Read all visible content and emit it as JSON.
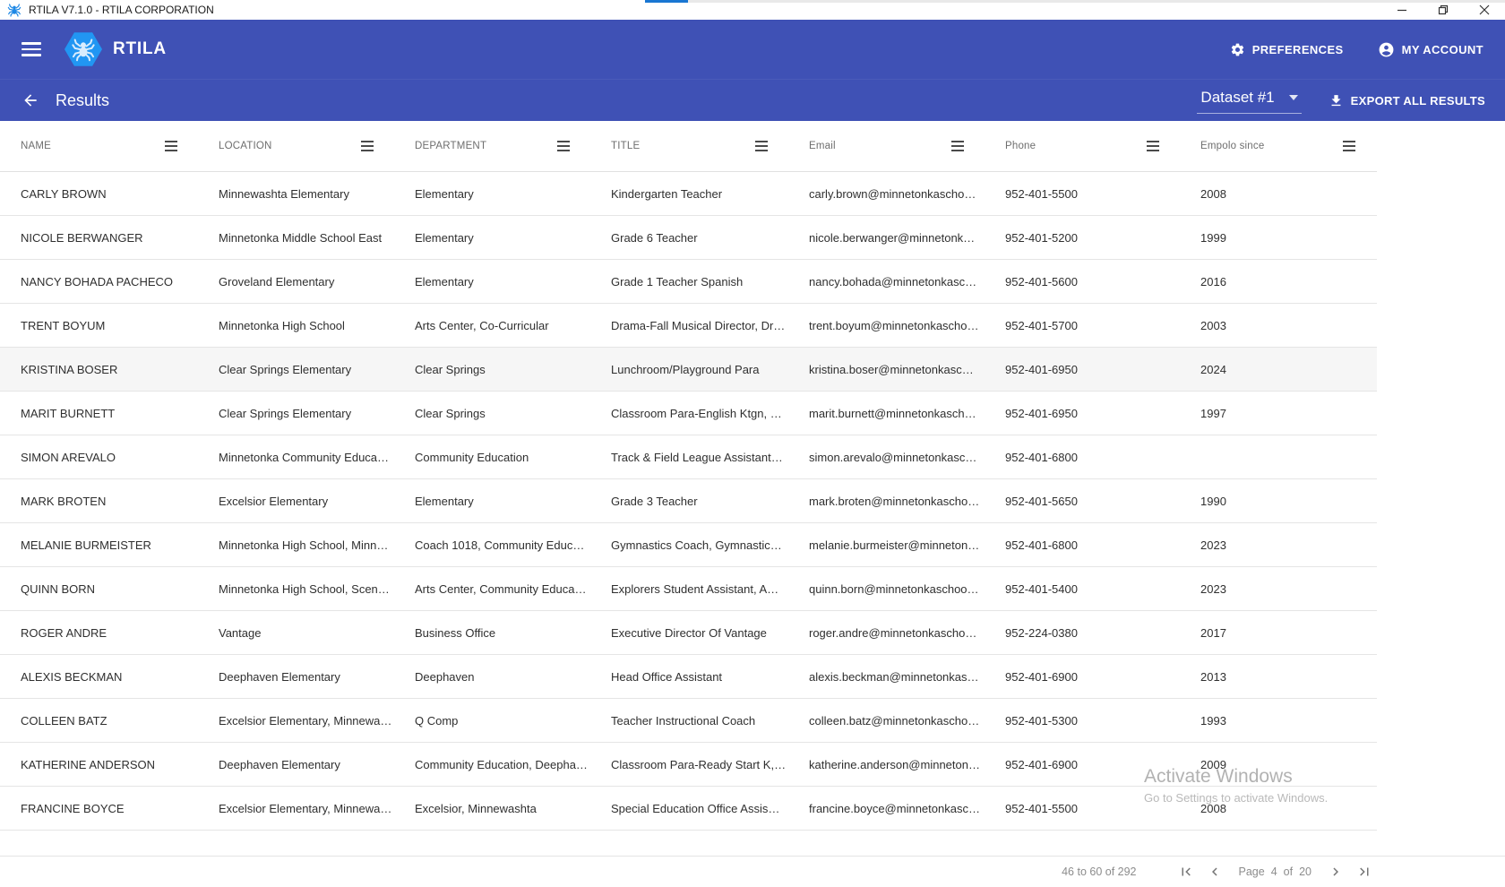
{
  "window": {
    "title": "RTILA V7.1.0 - RTILA CORPORATION"
  },
  "app_header": {
    "brand": "RTILA",
    "preferences_label": "PREFERENCES",
    "my_account_label": "MY ACCOUNT"
  },
  "results_bar": {
    "title": "Results",
    "dataset_label": "Dataset #1",
    "export_label": "EXPORT ALL RESULTS"
  },
  "table": {
    "fields": [
      "name",
      "location",
      "department",
      "title",
      "email",
      "phone",
      "employed_since"
    ],
    "columns": [
      {
        "label": "NAME"
      },
      {
        "label": "LOCATION"
      },
      {
        "label": "DEPARTMENT"
      },
      {
        "label": "TITLE"
      },
      {
        "label": "Email"
      },
      {
        "label": "Phone"
      },
      {
        "label": "Empolo since"
      }
    ],
    "rows": [
      {
        "highlighted": false,
        "cells": [
          "CARLY BROWN",
          "Minnewashta Elementary",
          "Elementary",
          "Kindergarten Teacher",
          "carly.brown@minnetonkascho…",
          "952-401-5500",
          "2008"
        ]
      },
      {
        "highlighted": false,
        "cells": [
          "NICOLE BERWANGER",
          "Minnetonka Middle School East",
          "Elementary",
          "Grade 6 Teacher",
          "nicole.berwanger@minnetonk…",
          "952-401-5200",
          "1999"
        ]
      },
      {
        "highlighted": false,
        "cells": [
          "NANCY BOHADA PACHECO",
          "Groveland Elementary",
          "Elementary",
          "Grade 1 Teacher Spanish",
          "nancy.bohada@minnetonkasc…",
          "952-401-5600",
          "2016"
        ]
      },
      {
        "highlighted": false,
        "cells": [
          "TRENT BOYUM",
          "Minnetonka High School",
          "Arts Center, Co-Curricular",
          "Drama-Fall Musical Director, Dr…",
          "trent.boyum@minnetonkascho…",
          "952-401-5700",
          "2003"
        ]
      },
      {
        "highlighted": true,
        "cells": [
          "KRISTINA BOSER",
          "Clear Springs Elementary",
          "Clear Springs",
          "Lunchroom/Playground Para",
          "kristina.boser@minnetonkasc…",
          "952-401-6950",
          "2024"
        ]
      },
      {
        "highlighted": false,
        "cells": [
          "MARIT BURNETT",
          "Clear Springs Elementary",
          "Clear Springs",
          "Classroom Para-English Ktgn, …",
          "marit.burnett@minnetonkasch…",
          "952-401-6950",
          "1997"
        ]
      },
      {
        "highlighted": false,
        "cells": [
          "SIMON AREVALO",
          "Minnetonka Community Educa…",
          "Community Education",
          "Track & Field League Assistant…",
          "simon.arevalo@minnetonkasc…",
          "952-401-6800",
          ""
        ]
      },
      {
        "highlighted": false,
        "cells": [
          "MARK BROTEN",
          "Excelsior Elementary",
          "Elementary",
          "Grade 3 Teacher",
          "mark.broten@minnetonkascho…",
          "952-401-5650",
          "1990"
        ]
      },
      {
        "highlighted": false,
        "cells": [
          "MELANIE BURMEISTER",
          "Minnetonka High School, Minn…",
          "Coach 1018, Community Educ…",
          "Gymnastics Coach, Gymnastic…",
          "melanie.burmeister@minneton…",
          "952-401-6800",
          "2023"
        ]
      },
      {
        "highlighted": false,
        "cells": [
          "QUINN BORN",
          "Minnetonka High School, Scen…",
          "Arts Center, Community Educa…",
          "Explorers Student Assistant, A…",
          "quinn.born@minnetonkaschoo…",
          "952-401-5400",
          "2023"
        ]
      },
      {
        "highlighted": false,
        "cells": [
          "ROGER ANDRE",
          "Vantage",
          "Business Office",
          "Executive Director Of Vantage",
          "roger.andre@minnetonkascho…",
          "952-224-0380",
          "2017"
        ]
      },
      {
        "highlighted": false,
        "cells": [
          "ALEXIS BECKMAN",
          "Deephaven Elementary",
          "Deephaven",
          "Head Office Assistant",
          "alexis.beckman@minnetonkas…",
          "952-401-6900",
          "2013"
        ]
      },
      {
        "highlighted": false,
        "cells": [
          "COLLEEN BATZ",
          "Excelsior Elementary, Minnewa…",
          "Q Comp",
          "Teacher Instructional Coach",
          "colleen.batz@minnetonkascho…",
          "952-401-5300",
          "1993"
        ]
      },
      {
        "highlighted": false,
        "cells": [
          "KATHERINE ANDERSON",
          "Deephaven Elementary",
          "Community Education, Deepha…",
          "Classroom Para-Ready Start K,…",
          "katherine.anderson@minneton…",
          "952-401-6900",
          "2009"
        ]
      },
      {
        "highlighted": false,
        "cells": [
          "FRANCINE BOYCE",
          "Excelsior Elementary, Minnewa…",
          "Excelsior, Minnewashta",
          "Special Education Office Assis…",
          "francine.boyce@minnetonkasc…",
          "952-401-5500",
          "2008"
        ]
      }
    ]
  },
  "footer": {
    "range": "46 to 60 of 292",
    "page_word": "Page",
    "current_page": "4",
    "of_word": "of",
    "total_pages": "20"
  },
  "watermark": {
    "title": "Activate Windows",
    "subtitle": "Go to Settings to activate Windows."
  },
  "colors": {
    "header_indigo": "#3F51B5",
    "brand_blue": "#2196F3",
    "progress_blue": "#1976D2",
    "row_highlight": "#F6F6F6",
    "divider": "#E5E5E5"
  }
}
